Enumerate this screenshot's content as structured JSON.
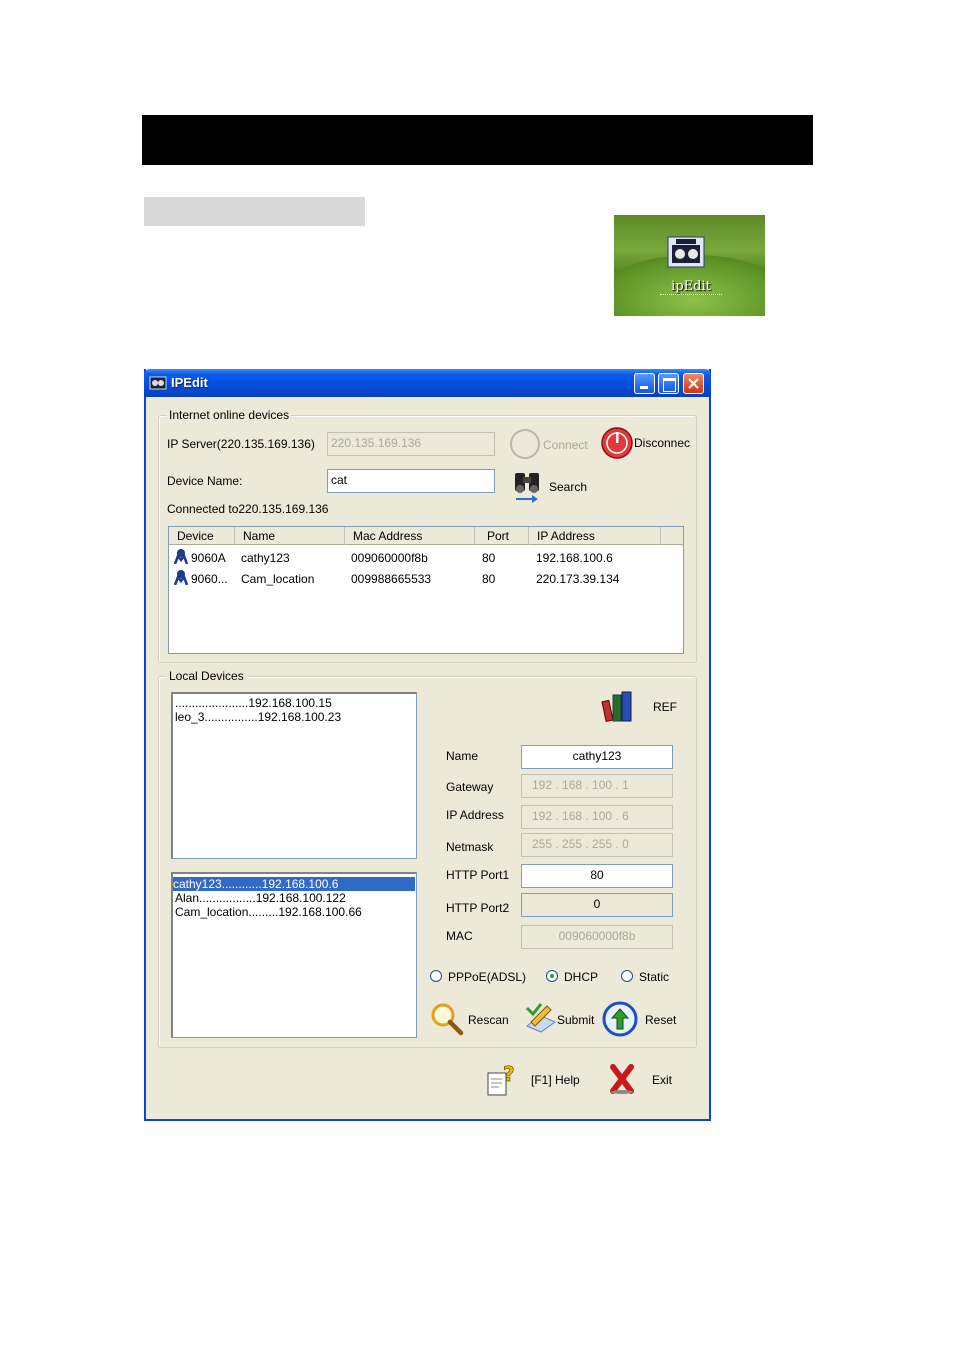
{
  "desktop_shortcut": {
    "label": "ipEdit"
  },
  "window": {
    "title": "IPEdit",
    "internet": {
      "group_title": "Internet online devices",
      "ip_server_label": "IP Server(220.135.169.136)",
      "ip_server_value": "220.135.169.136",
      "connect_label": "Connect",
      "disconnect_label": "Disconnec",
      "device_name_label": "Device Name:",
      "device_name_value": "cat",
      "search_label": "Search",
      "connected_text": "Connected to220.135.169.136",
      "columns": [
        "Device",
        "Name",
        "Mac Address",
        "Port",
        "IP Address"
      ],
      "rows": [
        {
          "device": "9060A",
          "name": "cathy123",
          "mac": "009060000f8b",
          "port": "80",
          "ip": "192.168.100.6"
        },
        {
          "device": "9060...",
          "name": "Cam_location",
          "mac": "009988665533",
          "port": "80",
          "ip": "220.173.39.134"
        }
      ]
    },
    "local": {
      "group_title": "Local Devices",
      "list_top": [
        "......................192.168.100.15",
        "leo_3................192.168.100.23"
      ],
      "list_bottom": [
        "cathy123............192.168.100.6",
        "Alan.................192.168.100.122",
        "Cam_location.........192.168.100.66"
      ],
      "ref_label": "REF",
      "fields": {
        "name_label": "Name",
        "name_value": "cathy123",
        "gateway_label": "Gateway",
        "gateway_value": "192  .  168  .  100  .    1",
        "ip_label": "IP Address",
        "ip_value": "192  .  168  .  100  .    6",
        "netmask_label": "Netmask",
        "netmask_value": "255  .  255  .  255  .    0",
        "http1_label": "HTTP Port1",
        "http1_value": "80",
        "http2_label": "HTTP Port2",
        "http2_value": "0",
        "mac_label": "MAC",
        "mac_value": "009060000f8b"
      },
      "radio": {
        "pppoe": "PPPoE(ADSL)",
        "dhcp": "DHCP",
        "static": "Static",
        "selected": "dhcp"
      },
      "rescan_label": "Rescan",
      "submit_label": "Submit",
      "reset_label": "Reset"
    },
    "help_label": "[F1] Help",
    "exit_label": "Exit"
  }
}
